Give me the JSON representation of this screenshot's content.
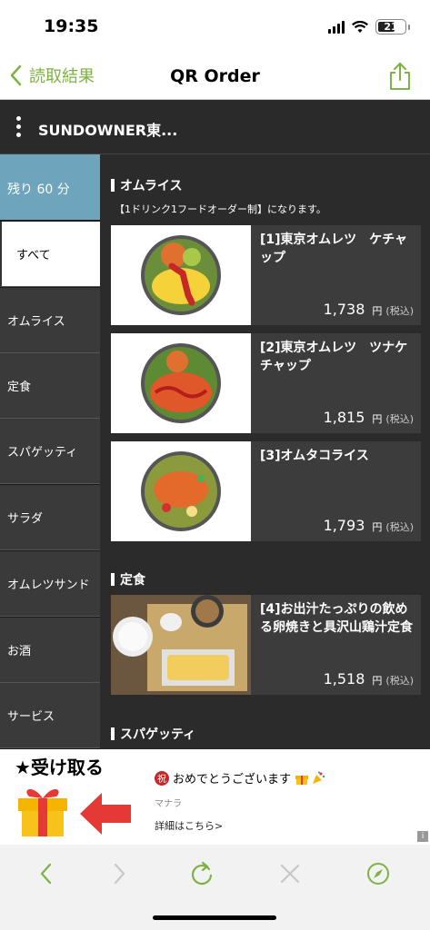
{
  "status_bar": {
    "time": "19:35",
    "battery": "21"
  },
  "nav": {
    "back_label": "読取結果",
    "title": "QR Order"
  },
  "shop": {
    "name": "SUNDOWNER東..."
  },
  "sidebar": {
    "timer": "残り 60 分",
    "items": [
      {
        "label": "すべて"
      },
      {
        "label": "オムライス"
      },
      {
        "label": "定食"
      },
      {
        "label": "スパゲッティ"
      },
      {
        "label": "サラダ"
      },
      {
        "label": "オムレツサンド"
      },
      {
        "label": "お酒"
      },
      {
        "label": "サービス"
      }
    ]
  },
  "sections": [
    {
      "title": "オムライス",
      "note": "【1ドリンク1フードオーダー制】になります。",
      "items": [
        {
          "name": "[1]東京オムレツ　ケチャップ",
          "price": "1,738",
          "unit": "円",
          "tax": "(税込)"
        },
        {
          "name": "[2]東京オムレツ　ツナケチャップ",
          "price": "1,815",
          "unit": "円",
          "tax": "(税込)"
        },
        {
          "name": "[3]オムタコライス",
          "price": "1,793",
          "unit": "円",
          "tax": "(税込)"
        }
      ]
    },
    {
      "title": "定食",
      "items": [
        {
          "name": "[4]お出汁たっぷりの飲める卵焼きと具沢山鶏汁定食",
          "price": "1,518",
          "unit": "円",
          "tax": "(税込)"
        }
      ]
    },
    {
      "title": "スパゲッティ"
    }
  ],
  "ad": {
    "receive_label": "★受け取る",
    "celebrate_glyph": "祝",
    "headline": "おめでとうございます",
    "source": "マナラ",
    "link": "詳細はこちら>",
    "info": "i"
  },
  "icons": {
    "back": "chevron-left-icon",
    "share": "share-icon",
    "menu": "vertical-dots-icon",
    "gift": "gift-icon",
    "arrow": "arrow-left-icon",
    "toolbar": [
      "back-icon",
      "forward-icon",
      "reload-icon",
      "close-icon",
      "compass-icon"
    ]
  },
  "colors": {
    "accent": "#7cb342",
    "timer_bg": "#6ea5bd",
    "dark_bg": "#2b2b2b"
  }
}
